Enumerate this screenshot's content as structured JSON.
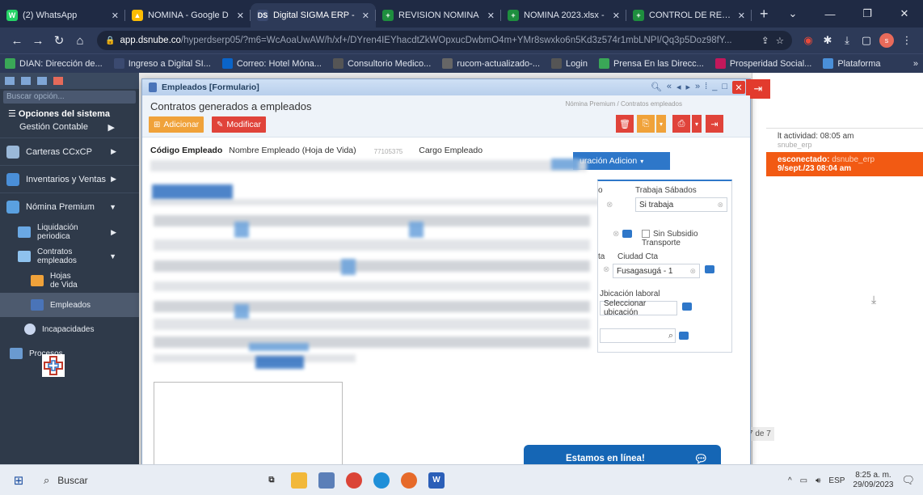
{
  "browser": {
    "tabs": [
      {
        "label": "(2) WhatsApp",
        "color": "#25d366",
        "glyph": "W"
      },
      {
        "label": "NOMINA - Google D",
        "color": "#fbbc04",
        "glyph": "▲"
      },
      {
        "label": "Digital SIGMA ERP -",
        "color": "#3b4a70",
        "glyph": "DS",
        "active": true
      },
      {
        "label": "REVISION NOMINA",
        "color": "#1e8e3e",
        "glyph": "+"
      },
      {
        "label": "NOMINA 2023.xlsx -",
        "color": "#1e8e3e",
        "glyph": "+"
      },
      {
        "label": "CONTROL DE RETEN",
        "color": "#1e8e3e",
        "glyph": "+"
      }
    ],
    "url_host": "app.dsnube.co",
    "url_path": "/hyperdserp05/?m6=WcAoaUwAW/h/xf+/DYren4IEYhacdtZkWOpxucDwbmO4m+YMr8swxko6n5Kd3z574r1mbLNPI/Qq3p5Doz98fY..."
  },
  "bookmarks": [
    {
      "label": "DIAN: Dirección de...",
      "color": "#3aa757"
    },
    {
      "label": "Ingreso a Digital SI...",
      "color": "#3b4a70"
    },
    {
      "label": "Correo: Hotel Móna...",
      "color": "#0a64c8"
    },
    {
      "label": "Consultorio Medico...",
      "color": "#555"
    },
    {
      "label": "rucom-actualizado-...",
      "color": "#666"
    },
    {
      "label": "Login",
      "color": "#555"
    },
    {
      "label": "Prensa En las Direcc...",
      "color": "#3aa757"
    },
    {
      "label": "Prosperidad Social...",
      "color": "#c2185b"
    },
    {
      "label": "Plataforma",
      "color": "#4a8fd8"
    }
  ],
  "sidebar": {
    "search_placeholder": "Buscar opción...",
    "header": "Opciones del sistema",
    "gestion": "Gestión Contable",
    "items": [
      {
        "label": "Carteras CCxCP"
      },
      {
        "label": "Inventarios y Ventas"
      },
      {
        "label": "Nómina Premium"
      }
    ],
    "children": [
      {
        "label": "Liquidación periodica"
      },
      {
        "label": "Contratos empleados"
      }
    ],
    "deep": [
      {
        "label": "Hojas de Vida"
      },
      {
        "label": "Empleados"
      }
    ],
    "incapacidades": "Incapacidades",
    "procesos": "Procesos"
  },
  "modal": {
    "title": "Empleados [Formulario]",
    "heading": "Contratos generados a empleados",
    "breadcrumb": "Nómina Premium / Contratos empleados",
    "add_label": "Adicionar",
    "modify_label": "Modificar",
    "col_codigo": "Código Empleado",
    "col_nombre": "Nombre Empleado (Hoja de Vida)",
    "col_num": "77105375",
    "col_cargo": "Cargo Empleado",
    "config_btn": "uración Adicion"
  },
  "right_panel": {
    "trabaja_label": "Trabaja Sábados",
    "trabaja_value": "Si trabaja",
    "sin_subsidio": "Sin Subsidio Transporte",
    "ciudad_label": "Ciudad Cta",
    "ciudad_prefix": "ta",
    "ciudad_value": "Fusagasugá - 1",
    "ubicacion_label": "Jbicación laboral",
    "ubicacion_btn": "Seleccionar ubicación",
    "small_o": "o"
  },
  "background": {
    "activity_1": "lt actividad: 08:05 am",
    "activity_1_user": "snube_erp",
    "activity_2": "esconectado:",
    "activity_2_user": "dsnube_erp",
    "activity_2_date": "9/sept./23 08:04 am",
    "pager": "7 de 7"
  },
  "chat": {
    "label": "Estamos en línea!"
  },
  "taskbar": {
    "search": "Buscar",
    "lang": "ESP",
    "time": "8:25 a. m.",
    "date": "29/09/2023"
  }
}
